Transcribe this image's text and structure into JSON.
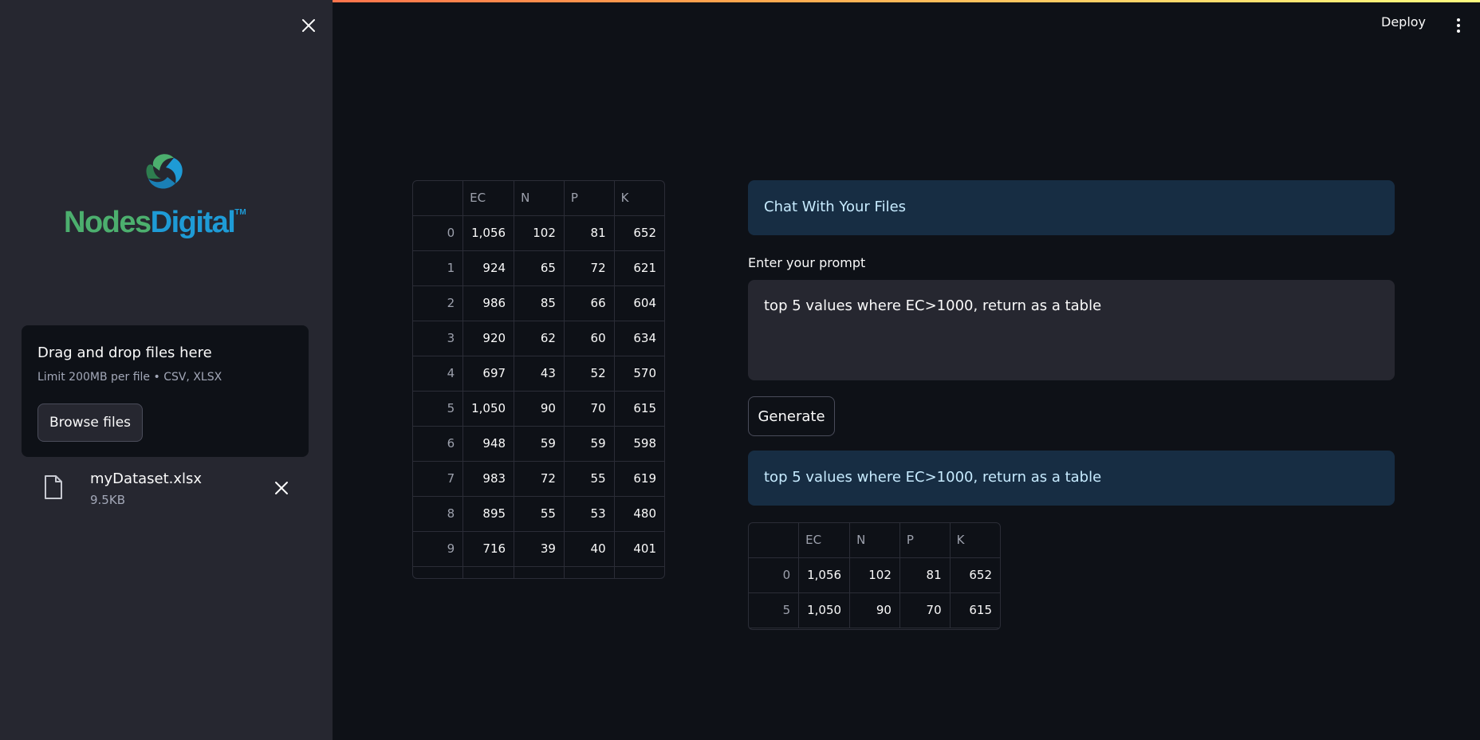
{
  "header": {
    "deploy_label": "Deploy",
    "menu_icon": "kebab-menu-icon"
  },
  "sidebar": {
    "close_icon": "close-icon",
    "logo": {
      "word1": "Nodes",
      "word2": "Digital",
      "tm": "TM"
    },
    "uploader": {
      "title": "Drag and drop files here",
      "limit": "Limit 200MB per file • CSV, XLSX",
      "browse_label": "Browse files"
    },
    "file": {
      "name": "myDataset.xlsx",
      "size": "9.5KB",
      "icon": "file-icon"
    }
  },
  "data_table": {
    "columns": [
      "",
      "EC",
      "N",
      "P",
      "K"
    ],
    "rows": [
      [
        "0",
        "1,056",
        "102",
        "81",
        "652"
      ],
      [
        "1",
        "924",
        "65",
        "72",
        "621"
      ],
      [
        "2",
        "986",
        "85",
        "66",
        "604"
      ],
      [
        "3",
        "920",
        "62",
        "60",
        "634"
      ],
      [
        "4",
        "697",
        "43",
        "52",
        "570"
      ],
      [
        "5",
        "1,050",
        "90",
        "70",
        "615"
      ],
      [
        "6",
        "948",
        "59",
        "59",
        "598"
      ],
      [
        "7",
        "983",
        "72",
        "55",
        "619"
      ],
      [
        "8",
        "895",
        "55",
        "53",
        "480"
      ],
      [
        "9",
        "716",
        "39",
        "40",
        "401"
      ]
    ]
  },
  "chat": {
    "title": "Chat With Your Files",
    "prompt_label": "Enter your prompt",
    "prompt_value": "top 5 values where EC>1000, return as a table",
    "generate_label": "Generate",
    "response_text": "top 5 values where EC>1000, return as a table"
  },
  "result_table": {
    "columns": [
      "",
      "EC",
      "N",
      "P",
      "K"
    ],
    "rows": [
      [
        "0",
        "1,056",
        "102",
        "81",
        "652"
      ],
      [
        "5",
        "1,050",
        "90",
        "70",
        "615"
      ]
    ]
  }
}
